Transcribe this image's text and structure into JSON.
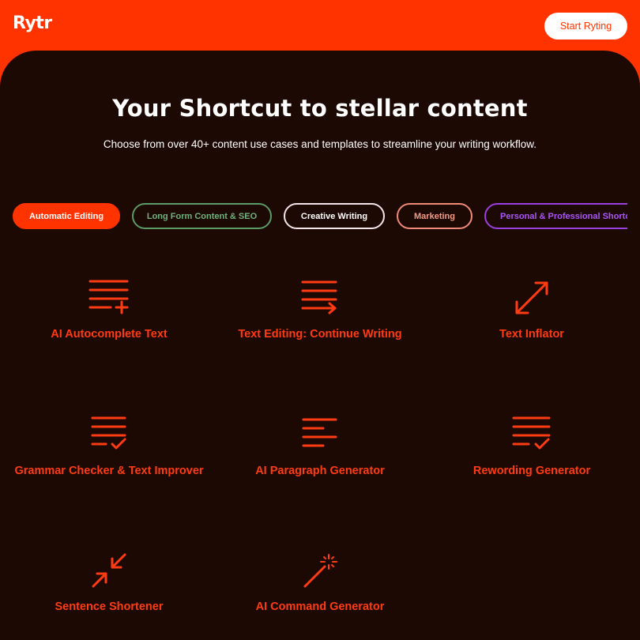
{
  "header": {
    "logo_text": "Rytr",
    "cta_label": "Start Ryting"
  },
  "hero": {
    "title": "Your Shortcut to stellar content",
    "subtitle": "Choose from over 40+ content use cases and templates to streamline your writing workflow."
  },
  "tabs": [
    {
      "label": "Automatic Editing",
      "active": true
    },
    {
      "label": "Long Form Content & SEO",
      "active": false
    },
    {
      "label": "Creative Writing",
      "active": false
    },
    {
      "label": "Marketing",
      "active": false
    },
    {
      "label": "Personal & Professional Shortcuts",
      "active": false
    }
  ],
  "use_cases": [
    {
      "label": "AI Autocomplete Text",
      "icon": "lines-plus-icon"
    },
    {
      "label": "Text Editing: Continue Writing",
      "icon": "lines-arrow-icon"
    },
    {
      "label": "Text Inflator",
      "icon": "expand-arrows-icon"
    },
    {
      "label": "Grammar Checker & Text Improver",
      "icon": "lines-check-icon"
    },
    {
      "label": "AI Paragraph Generator",
      "icon": "paragraph-lines-icon"
    },
    {
      "label": "Rewording Generator",
      "icon": "lines-check-icon"
    },
    {
      "label": "Sentence Shortener",
      "icon": "shrink-arrows-icon"
    },
    {
      "label": "AI Command Generator",
      "icon": "magic-wand-icon"
    }
  ],
  "colors": {
    "brand": "#ff3300",
    "panel_bg": "#1d0904",
    "accent_text": "#ff3b14"
  }
}
